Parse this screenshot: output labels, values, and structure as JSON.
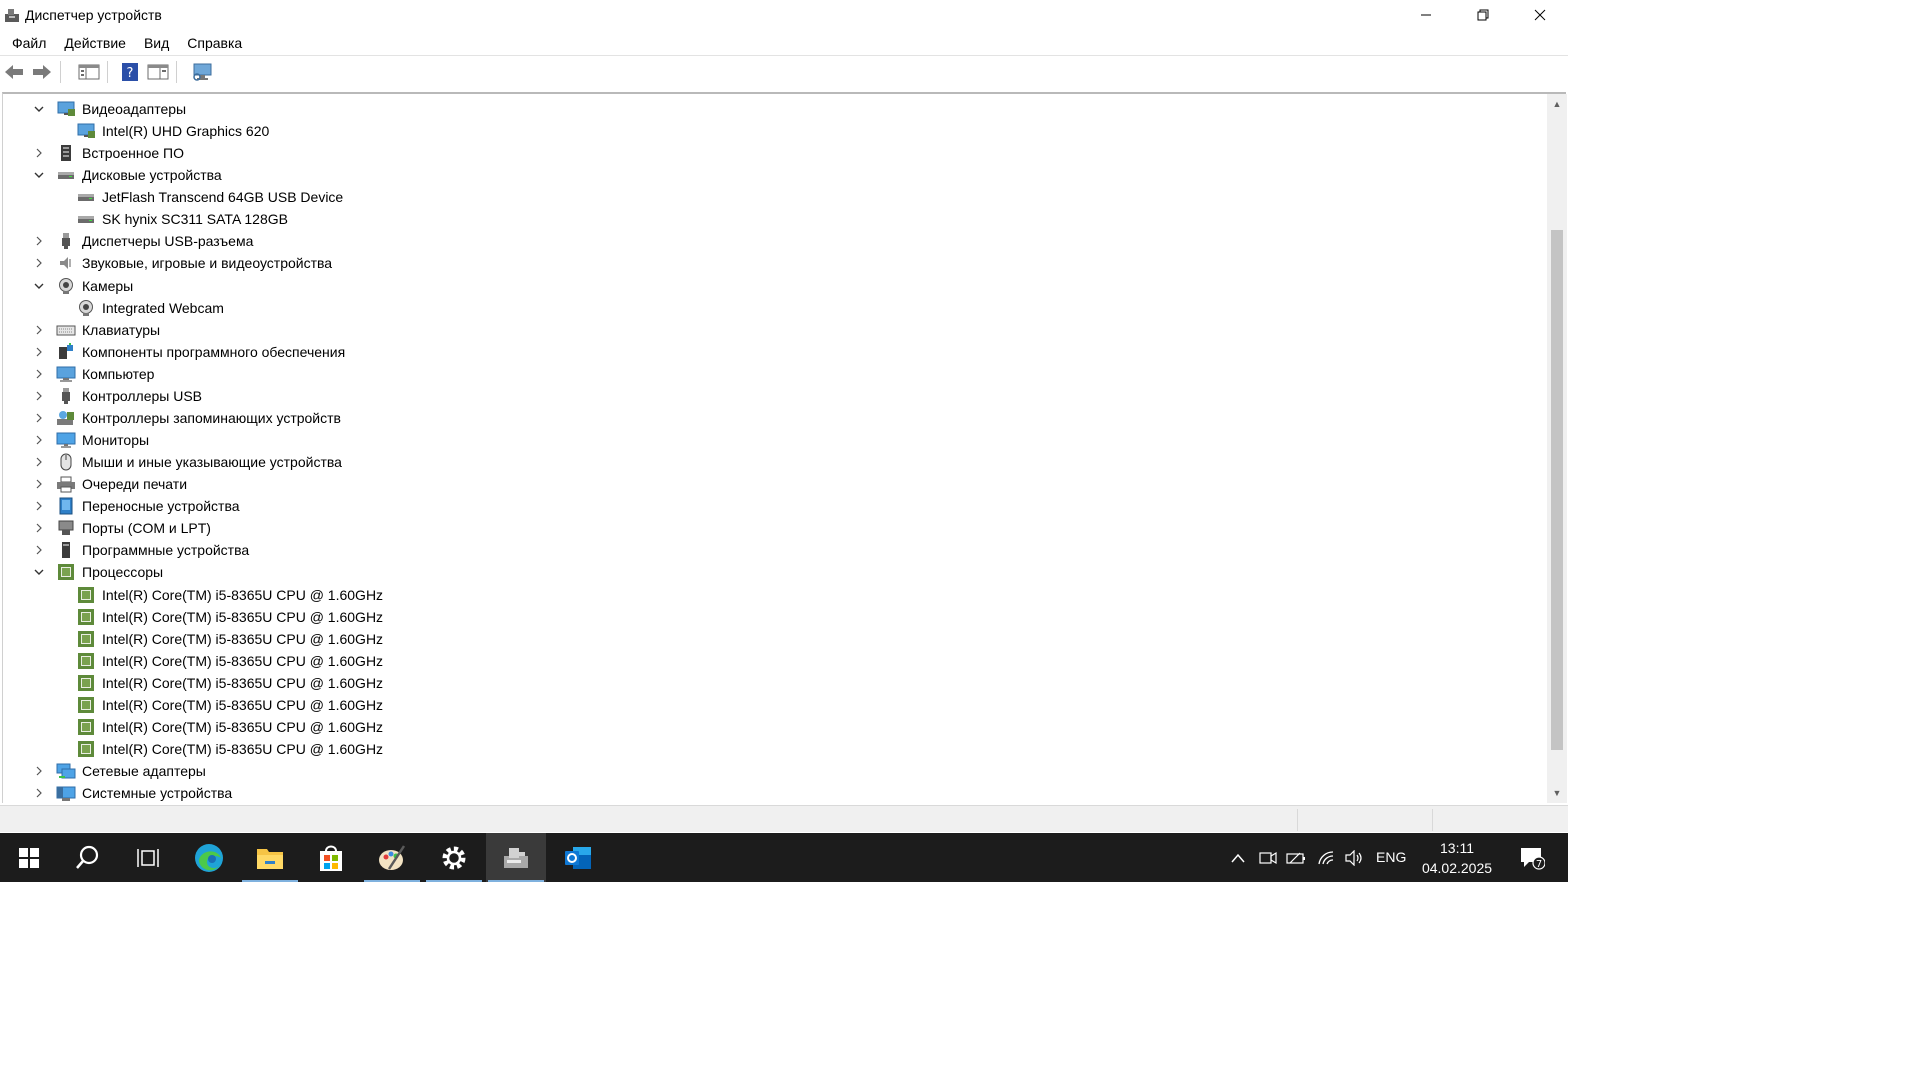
{
  "window": {
    "title": "Диспетчер устройств"
  },
  "menu": [
    "Файл",
    "Действие",
    "Вид",
    "Справка"
  ],
  "tree": [
    {
      "label": "Видеоадаптеры",
      "level": 0,
      "expanded": true,
      "icon": "display-adapter-icon"
    },
    {
      "label": "Intel(R) UHD Graphics 620",
      "level": 1,
      "icon": "display-adapter-icon"
    },
    {
      "label": "Встроенное ПО",
      "level": 0,
      "expanded": false,
      "icon": "firmware-icon"
    },
    {
      "label": "Дисковые устройства",
      "level": 0,
      "expanded": true,
      "icon": "disk-drive-icon"
    },
    {
      "label": "JetFlash Transcend 64GB USB Device",
      "level": 1,
      "icon": "disk-drive-icon"
    },
    {
      "label": "SK hynix SC311 SATA 128GB",
      "level": 1,
      "icon": "disk-drive-icon"
    },
    {
      "label": "Диспетчеры USB-разъема",
      "level": 0,
      "expanded": false,
      "icon": "usb-connector-icon"
    },
    {
      "label": "Звуковые, игровые и видеоустройства",
      "level": 0,
      "expanded": false,
      "icon": "sound-icon"
    },
    {
      "label": "Камеры",
      "level": 0,
      "expanded": true,
      "icon": "camera-icon"
    },
    {
      "label": "Integrated Webcam",
      "level": 1,
      "icon": "camera-icon"
    },
    {
      "label": "Клавиатуры",
      "level": 0,
      "expanded": false,
      "icon": "keyboard-icon"
    },
    {
      "label": "Компоненты программного обеспечения",
      "level": 0,
      "expanded": false,
      "icon": "software-component-icon"
    },
    {
      "label": "Компьютер",
      "level": 0,
      "expanded": false,
      "icon": "computer-icon"
    },
    {
      "label": "Контроллеры USB",
      "level": 0,
      "expanded": false,
      "icon": "usb-controller-icon"
    },
    {
      "label": "Контроллеры запоминающих устройств",
      "level": 0,
      "expanded": false,
      "icon": "storage-controller-icon"
    },
    {
      "label": "Мониторы",
      "level": 0,
      "expanded": false,
      "icon": "monitor-icon"
    },
    {
      "label": "Мыши и иные указывающие устройства",
      "level": 0,
      "expanded": false,
      "icon": "mouse-icon"
    },
    {
      "label": "Очереди печати",
      "level": 0,
      "expanded": false,
      "icon": "printer-icon"
    },
    {
      "label": "Переносные устройства",
      "level": 0,
      "expanded": false,
      "icon": "portable-device-icon"
    },
    {
      "label": "Порты (COM и LPT)",
      "level": 0,
      "expanded": false,
      "icon": "port-icon"
    },
    {
      "label": "Программные устройства",
      "level": 0,
      "expanded": false,
      "icon": "software-device-icon"
    },
    {
      "label": "Процессоры",
      "level": 0,
      "expanded": true,
      "icon": "processor-icon"
    },
    {
      "label": "Intel(R) Core(TM) i5-8365U CPU @ 1.60GHz",
      "level": 1,
      "icon": "processor-icon"
    },
    {
      "label": "Intel(R) Core(TM) i5-8365U CPU @ 1.60GHz",
      "level": 1,
      "icon": "processor-icon"
    },
    {
      "label": "Intel(R) Core(TM) i5-8365U CPU @ 1.60GHz",
      "level": 1,
      "icon": "processor-icon"
    },
    {
      "label": "Intel(R) Core(TM) i5-8365U CPU @ 1.60GHz",
      "level": 1,
      "icon": "processor-icon"
    },
    {
      "label": "Intel(R) Core(TM) i5-8365U CPU @ 1.60GHz",
      "level": 1,
      "icon": "processor-icon"
    },
    {
      "label": "Intel(R) Core(TM) i5-8365U CPU @ 1.60GHz",
      "level": 1,
      "icon": "processor-icon"
    },
    {
      "label": "Intel(R) Core(TM) i5-8365U CPU @ 1.60GHz",
      "level": 1,
      "icon": "processor-icon"
    },
    {
      "label": "Intel(R) Core(TM) i5-8365U CPU @ 1.60GHz",
      "level": 1,
      "icon": "processor-icon"
    },
    {
      "label": "Сетевые адаптеры",
      "level": 0,
      "expanded": false,
      "icon": "network-adapter-icon"
    },
    {
      "label": "Системные устройства",
      "level": 0,
      "expanded": false,
      "icon": "system-device-icon"
    }
  ],
  "taskbar": {
    "apps": [
      "start-icon",
      "search-icon",
      "task-view-icon",
      "edge-icon",
      "file-explorer-icon",
      "store-icon",
      "paint-icon",
      "settings-icon",
      "device-manager-icon",
      "outlook-icon"
    ],
    "lang": "ENG",
    "time": "13:11",
    "date": "04.02.2025",
    "notification_count": "7"
  }
}
